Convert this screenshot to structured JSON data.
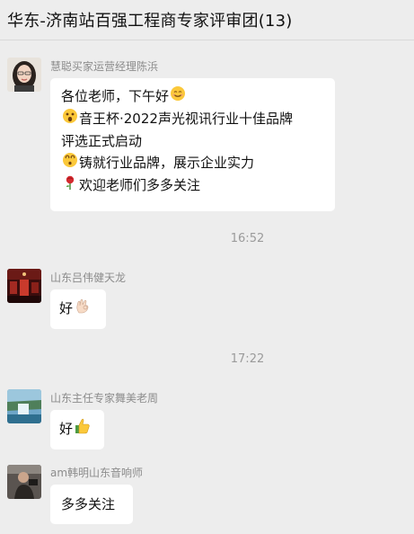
{
  "header": {
    "title": "华东-济南站百强工程商专家评审团(13)"
  },
  "messages": [
    {
      "sender": "慧聪买家运营经理陈浜",
      "avatar_icon": "woman-photo-avatar",
      "lines": [
        {
          "text": "各位老师，下午好",
          "suffix_icon": "smile-emoji"
        },
        {
          "prefix_icon": "surprised-emoji",
          "text": "音王杯·2022声光视讯行业十佳品牌"
        },
        {
          "text": "评选正式启动"
        },
        {
          "prefix_icon": "dizzy-emoji",
          "text": "铸就行业品牌，展示企业实力"
        },
        {
          "prefix_icon": "rose-emoji",
          "text": "欢迎老师们多多关注"
        }
      ]
    },
    {
      "time": "16:52"
    },
    {
      "sender": "山东吕伟健天龙",
      "avatar_icon": "red-room-photo-avatar",
      "lines": [
        {
          "text": "好",
          "suffix_icon": "ok-hand-emoji"
        }
      ]
    },
    {
      "time": "17:22"
    },
    {
      "sender": "山东主任专家舞美老周",
      "avatar_icon": "waterfall-photo-avatar",
      "lines": [
        {
          "text": "好",
          "suffix_icon": "thumbs-up-emoji"
        }
      ]
    },
    {
      "sender": "am韩明山东音响师",
      "avatar_icon": "person-photo-avatar",
      "lines": [
        {
          "text": "多多关注"
        }
      ]
    }
  ]
}
